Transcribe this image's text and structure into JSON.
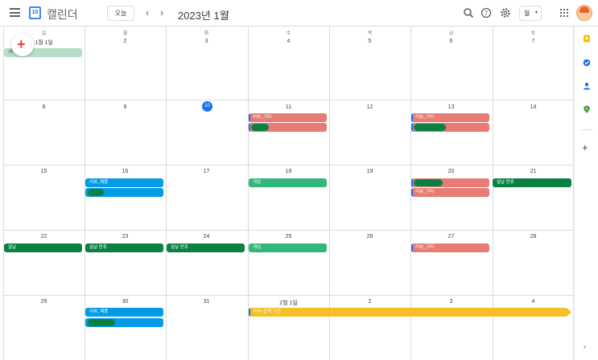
{
  "header": {
    "app_name": "캘린더",
    "logo_day": "10",
    "today_button": "오늘",
    "prev": "‹",
    "next": "›",
    "title": "2023년 1월",
    "view_select": "월",
    "caret": "▾"
  },
  "weekdays": [
    "일",
    "월",
    "화",
    "수",
    "목",
    "금",
    "토"
  ],
  "weeks": [
    [
      "1월 1일",
      "2",
      "3",
      "4",
      "5",
      "6",
      "7"
    ],
    [
      "8",
      "9",
      "10",
      "11",
      "12",
      "13",
      "14"
    ],
    [
      "15",
      "16",
      "17",
      "18",
      "19",
      "20",
      "21"
    ],
    [
      "22",
      "23",
      "24",
      "25",
      "26",
      "27",
      "28"
    ],
    [
      "29",
      "30",
      "31",
      "2월 1일",
      "2",
      "3",
      "4"
    ]
  ],
  "today": "10",
  "events": {
    "w1_sun": "새해",
    "w2_wed": "리뷰_기타",
    "w2_fri": "리뷰_기타",
    "w3_mon": "리뷰_제품",
    "w3_wed": "게임",
    "w3_fri": "리뷰_기타",
    "w3_sat": "설날 연휴",
    "w4_sun": "설날",
    "w4_mon": "설날 연휴",
    "w4_tue": "설날 연휴",
    "w4_wed": "게임",
    "w4_fri": "리뷰_기타",
    "w5_mon": "리뷰_제품",
    "w5_wed": "수능+합격 기간"
  },
  "colors": {
    "red": "#e67c73",
    "blue": "#039be5",
    "green": "#0b8043",
    "mint": "#33b679",
    "yellow": "#f6bf26",
    "today": "#1a73e8"
  },
  "sidebar": {
    "add": "+",
    "collapse": "›"
  }
}
